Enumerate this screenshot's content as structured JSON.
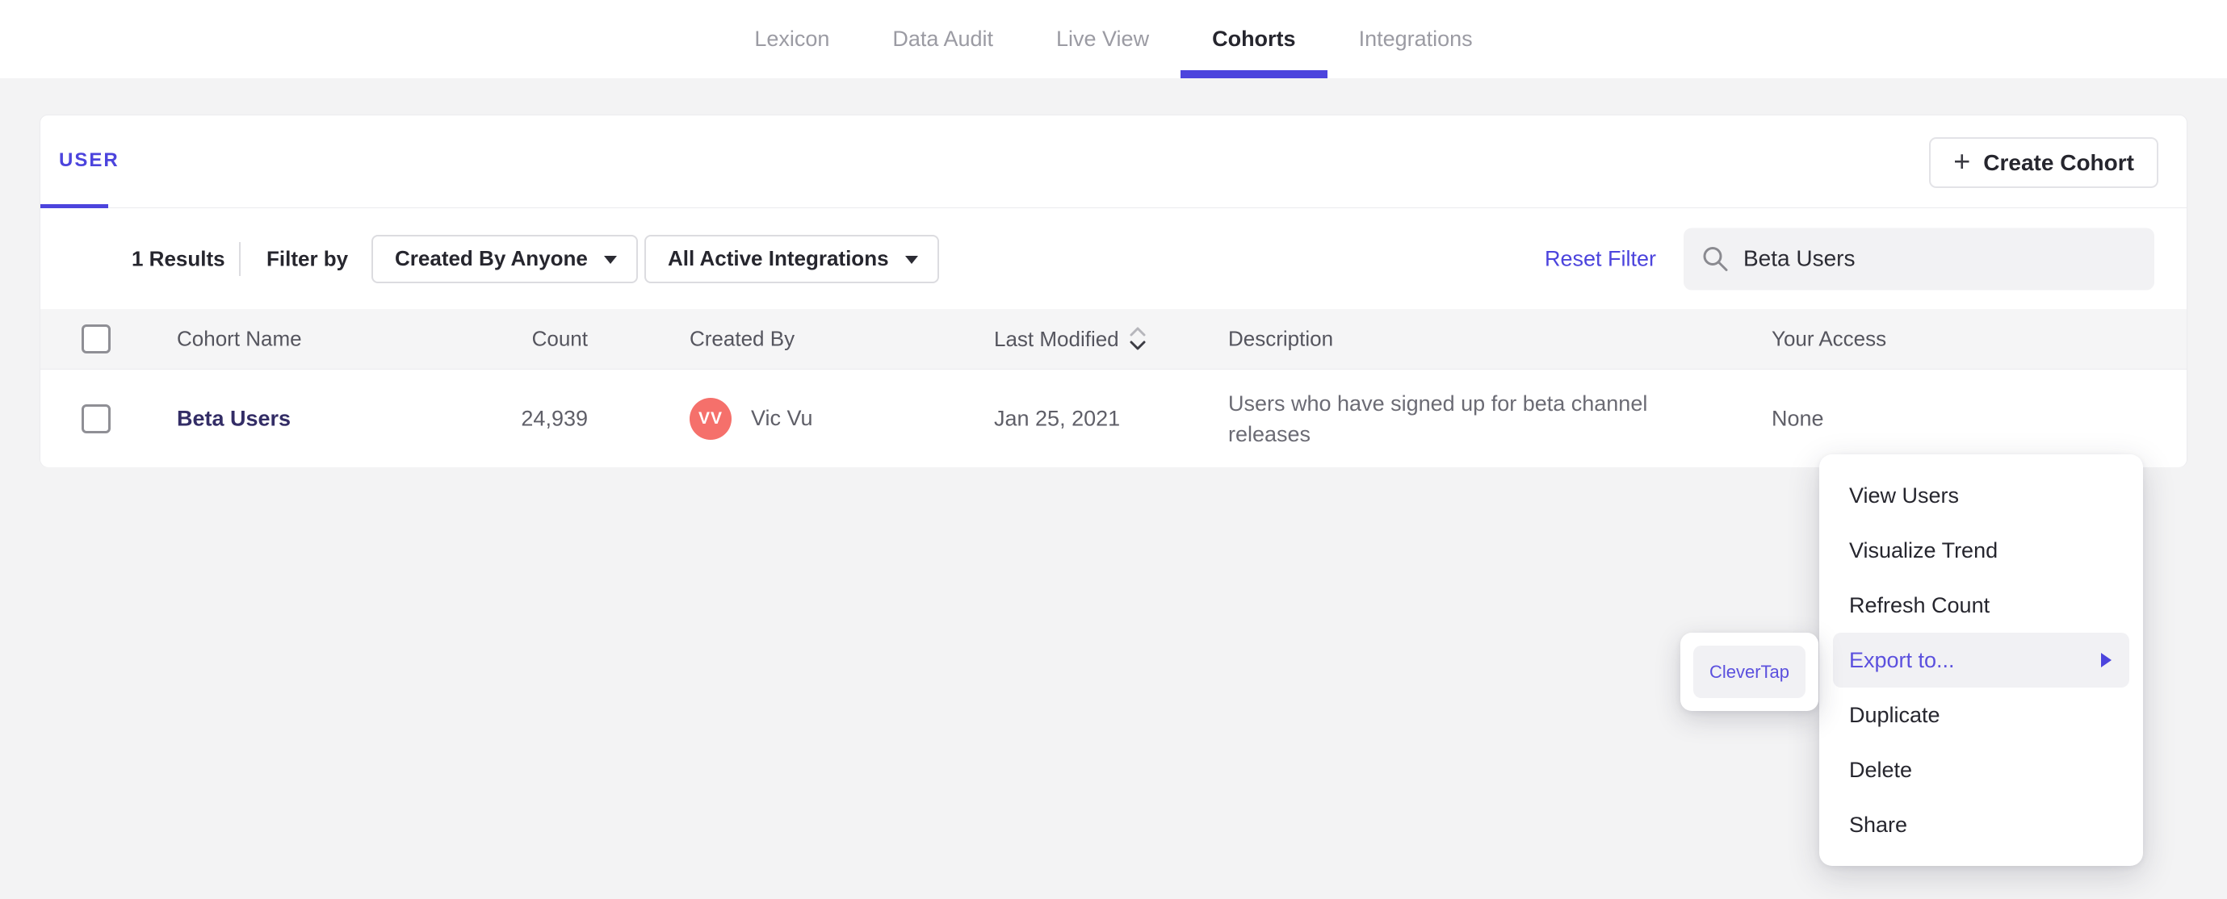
{
  "colors": {
    "accent": "#4c44dd",
    "menu_highlight_text": "#5b50de",
    "avatar_bg": "#f5706b",
    "cohort_link": "#332d66"
  },
  "nav": {
    "tabs": [
      {
        "label": "Lexicon",
        "active": false
      },
      {
        "label": "Data Audit",
        "active": false
      },
      {
        "label": "Live View",
        "active": false
      },
      {
        "label": "Cohorts",
        "active": true
      },
      {
        "label": "Integrations",
        "active": false
      }
    ]
  },
  "card": {
    "tab_label": "USER",
    "create_button_label": "Create Cohort",
    "icons": {
      "plus": "+"
    },
    "results_count": "1 Results",
    "filter_by_label": "Filter by",
    "filters": {
      "created_by": "Created By Anyone",
      "integrations": "All Active Integrations"
    },
    "reset_filter_label": "Reset Filter",
    "search": {
      "value": "Beta Users"
    },
    "table": {
      "headers": [
        "Cohort Name",
        "Count",
        "Created By",
        "Last Modified",
        "Description",
        "Your Access"
      ],
      "row": {
        "name": "Beta Users",
        "count": "24,939",
        "creator_initials": "VV",
        "creator_name": "Vic Vu",
        "last_modified": "Jan 25, 2021",
        "description": "Users who have signed up for beta channel releases",
        "access": "None"
      }
    }
  },
  "context_menu": {
    "items": [
      {
        "label": "View Users",
        "highlighted": false
      },
      {
        "label": "Visualize Trend",
        "highlighted": false
      },
      {
        "label": "Refresh Count",
        "highlighted": false
      },
      {
        "label": "Export to...",
        "highlighted": true,
        "has_submenu": true
      },
      {
        "label": "Duplicate",
        "highlighted": false
      },
      {
        "label": "Delete",
        "highlighted": false
      },
      {
        "label": "Share",
        "highlighted": false
      }
    ]
  },
  "submenu": {
    "item_label": "CleverTap"
  }
}
